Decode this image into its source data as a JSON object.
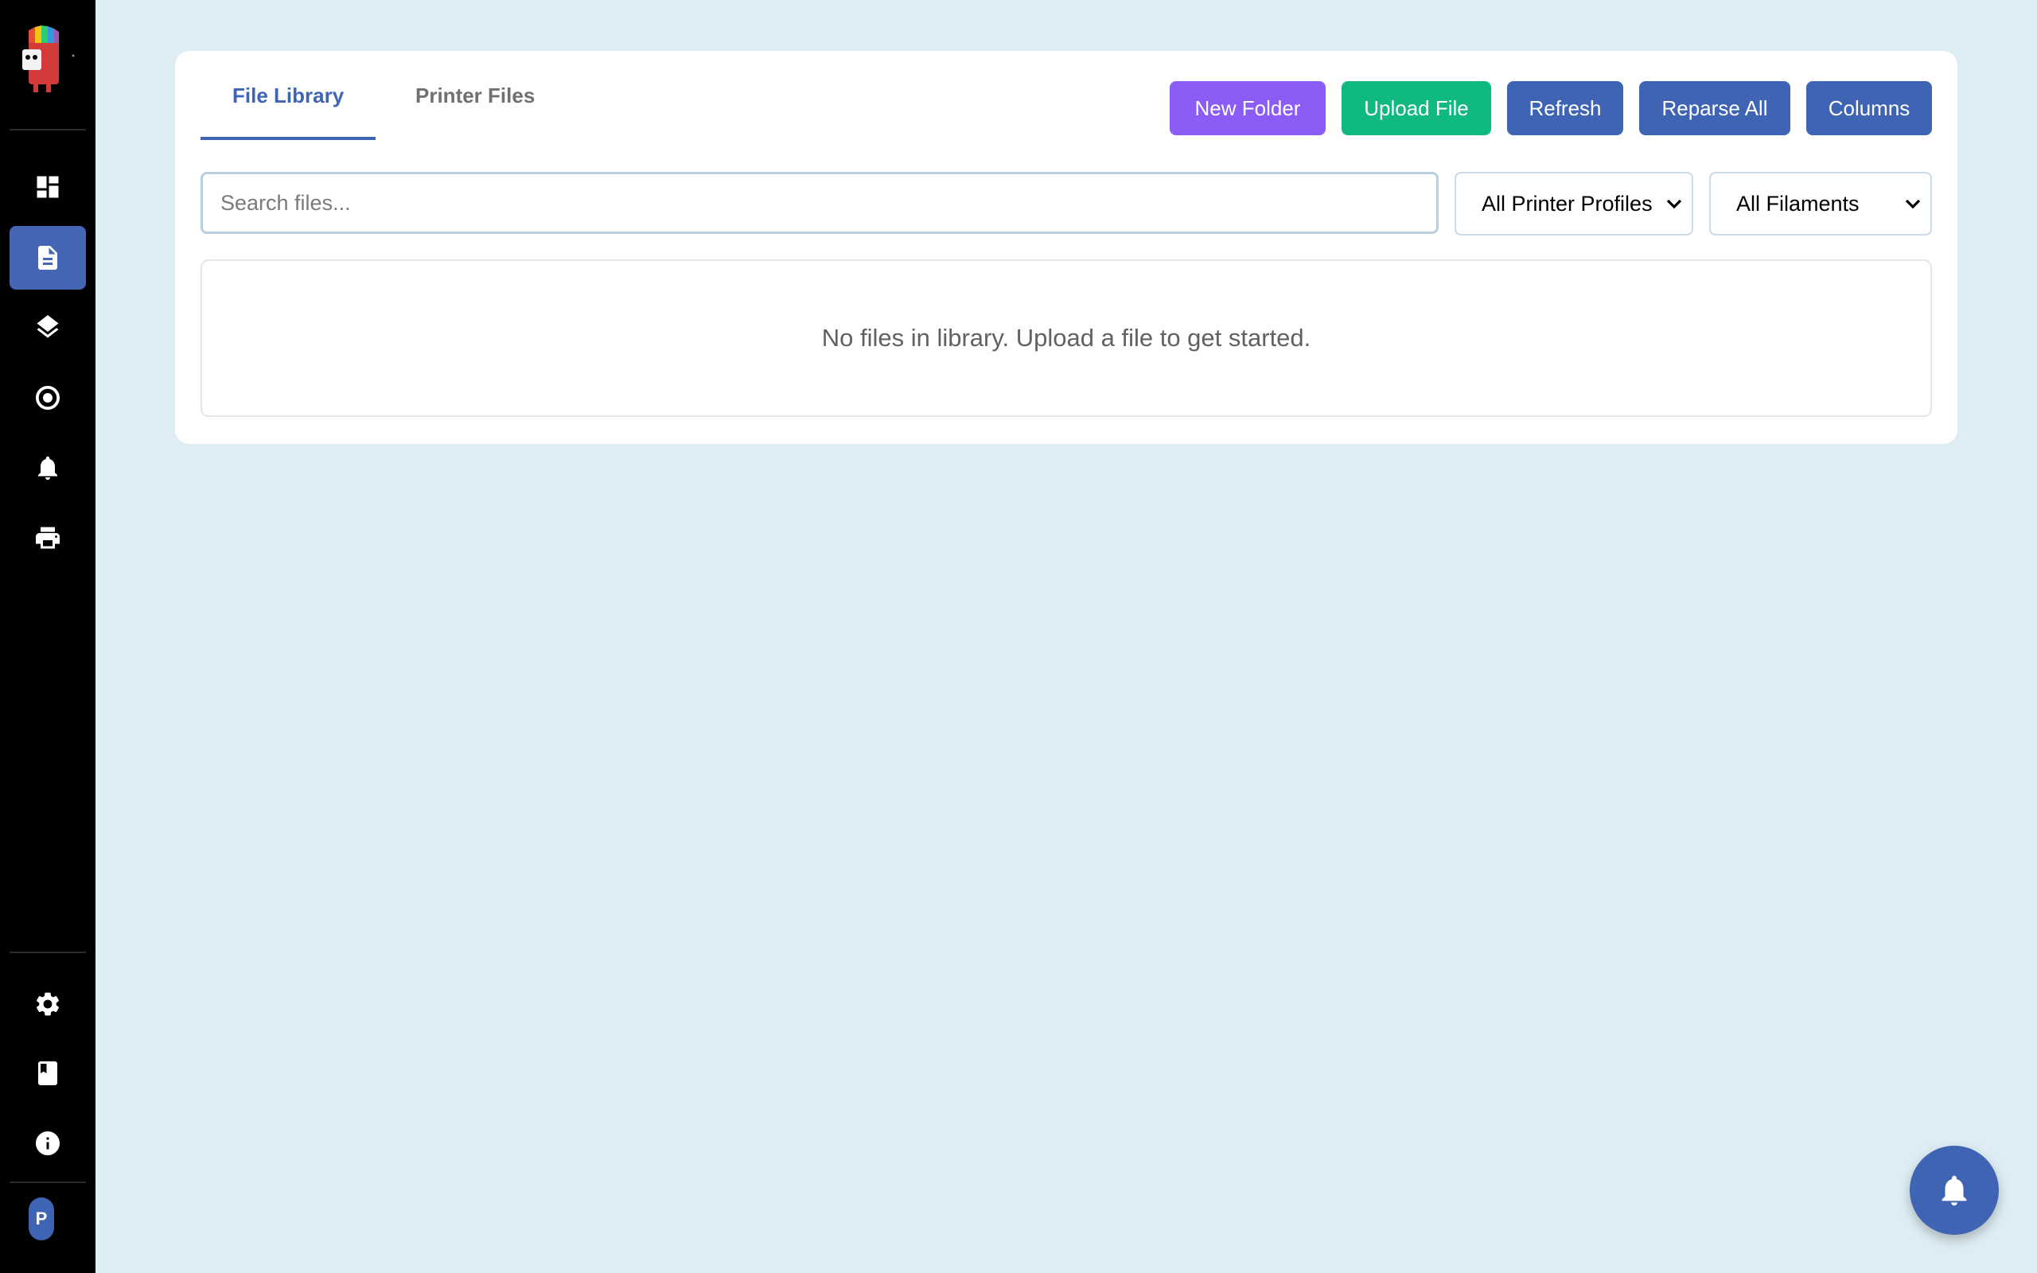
{
  "sidebar": {
    "nav": [
      {
        "name": "dashboard-icon",
        "active": false
      },
      {
        "name": "file-icon",
        "active": true
      },
      {
        "name": "layers-icon",
        "active": false
      },
      {
        "name": "target-icon",
        "active": false
      },
      {
        "name": "bell-icon",
        "active": false
      },
      {
        "name": "printer-icon",
        "active": false
      }
    ],
    "bottom": [
      "gear-icon",
      "book-icon",
      "info-icon"
    ],
    "avatar_initial": "P"
  },
  "tabs": [
    {
      "label": "File Library",
      "active": true
    },
    {
      "label": "Printer Files",
      "active": false
    }
  ],
  "toolbar": {
    "new_folder": "New Folder",
    "upload_file": "Upload File",
    "refresh": "Refresh",
    "reparse_all": "Reparse All",
    "columns": "Columns"
  },
  "colors": {
    "purple": "#8b5cf6",
    "green": "#10b981",
    "blue": "#3f64b4"
  },
  "search": {
    "placeholder": "Search files...",
    "value": ""
  },
  "filters": {
    "printer_profiles": "All Printer Profiles",
    "filaments": "All Filaments"
  },
  "empty_message": "No files in library. Upload a file to get started."
}
